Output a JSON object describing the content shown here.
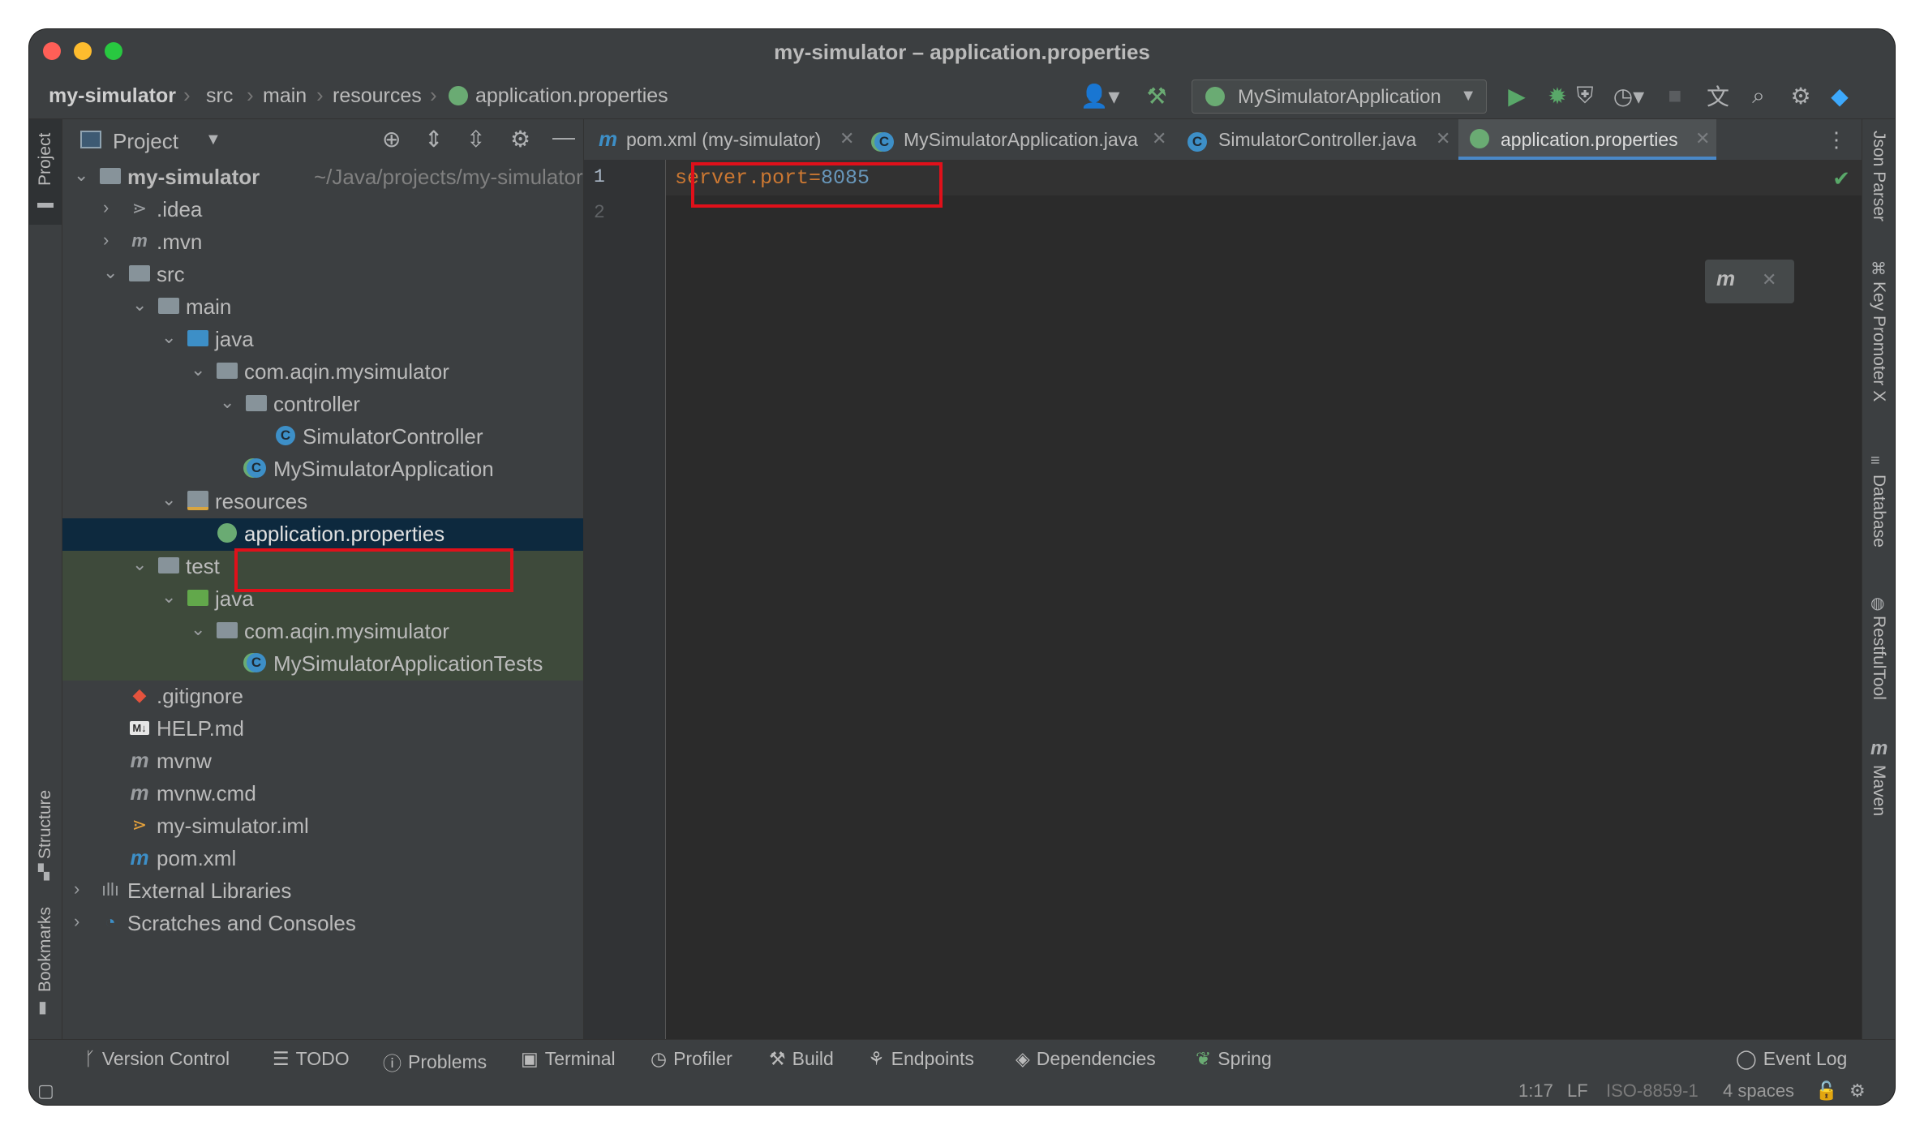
{
  "window": {
    "title": "my-simulator – application.properties"
  },
  "breadcrumb": {
    "project": "my-simulator",
    "items": [
      "src",
      "main",
      "resources",
      "application.properties"
    ]
  },
  "run_config": {
    "label": "MySimulatorApplication"
  },
  "project_panel": {
    "title": "Project"
  },
  "tree": {
    "root": {
      "name": "my-simulator",
      "path": "~/Java/projects/my-simulator"
    },
    "items": [
      ".idea",
      ".mvn",
      "src",
      "main",
      "java",
      "com.aqin.mysimulator",
      "controller",
      "SimulatorController",
      "MySimulatorApplication",
      "resources",
      "application.properties",
      "test",
      "java",
      "com.aqin.mysimulator",
      "MySimulatorApplicationTests",
      ".gitignore",
      "HELP.md",
      "mvnw",
      "mvnw.cmd",
      "my-simulator.iml",
      "pom.xml",
      "External Libraries",
      "Scratches and Consoles"
    ]
  },
  "tabs": [
    {
      "label": "pom.xml (my-simulator)"
    },
    {
      "label": "MySimulatorApplication.java"
    },
    {
      "label": "SimulatorController.java"
    },
    {
      "label": "application.properties"
    }
  ],
  "editor": {
    "line_numbers": [
      "1",
      "2"
    ],
    "key": "server.port",
    "eq": "=",
    "value": "8085"
  },
  "left_strip": {
    "project": "Project",
    "structure": "Structure",
    "bookmarks": "Bookmarks"
  },
  "right_strip": {
    "json_parser": "Json Parser",
    "key_promoter": "Key Promoter X",
    "database": "Database",
    "restful_tool": "RestfulTool",
    "maven": "Maven"
  },
  "tool_windows": [
    "Version Control",
    "TODO",
    "Problems",
    "Terminal",
    "Profiler",
    "Build",
    "Endpoints",
    "Dependencies",
    "Spring"
  ],
  "event_log": "Event Log",
  "status": {
    "position": "1:17",
    "line_sep": "LF",
    "encoding": "ISO-8859-1",
    "indent": "4 spaces"
  },
  "colors": {
    "accent": "#4a88c7",
    "highlight_box": "#e0101a",
    "selection": "#0d293e",
    "test_bg": "#3e4a3b"
  }
}
